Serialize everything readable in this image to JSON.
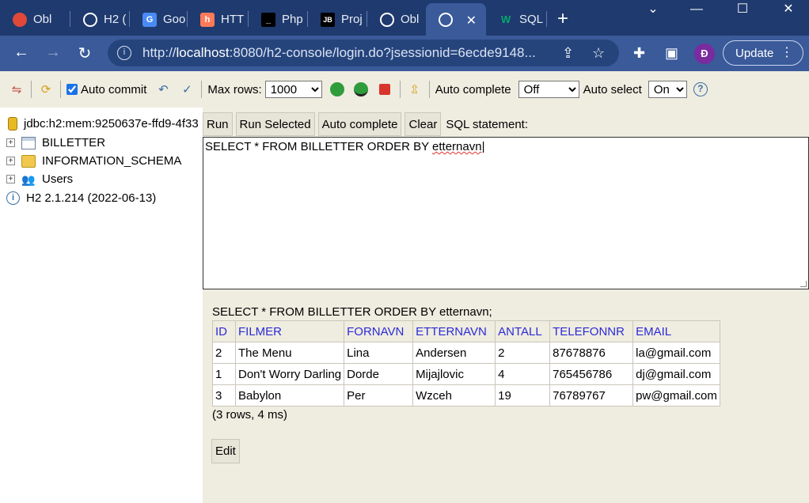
{
  "browser": {
    "tabs": [
      {
        "label": "Obl",
        "icon": "red-circle-icon",
        "color": "#e0483a"
      },
      {
        "label": "H2 (",
        "icon": "globe-icon",
        "color": "#ffffff"
      },
      {
        "label": "Goo",
        "icon": "google-translate-icon",
        "color": "#4a8af4"
      },
      {
        "label": "HTT",
        "icon": "hubspot-icon",
        "color": "#ff7a59"
      },
      {
        "label": "Php",
        "icon": "terminal-icon",
        "color": "#000000"
      },
      {
        "label": "Proj",
        "icon": "jetbrains-icon",
        "color": "#000000"
      },
      {
        "label": "Obl",
        "icon": "globe-icon",
        "color": "#ffffff"
      },
      {
        "label": "",
        "icon": "globe-icon",
        "color": "#ffffff",
        "active": true
      },
      {
        "label": "SQL",
        "icon": "w3schools-icon",
        "color": "#04aa6d"
      }
    ],
    "new_tab": "+",
    "url_host": "localhost",
    "url_prefix": "http://",
    "url_rest": ":8080/h2-console/login.do?jsessionid=6ecde9148...",
    "profile_initial": "Đ",
    "update_label": "Update"
  },
  "toolbar": {
    "auto_commit_label": "Auto commit",
    "max_rows_label": "Max rows:",
    "max_rows_value": "1000",
    "auto_complete_label": "Auto complete",
    "auto_complete_value": "Off",
    "auto_select_label": "Auto select",
    "auto_select_value": "On"
  },
  "tree": {
    "connection": "jdbc:h2:mem:9250637e-ffd9-4f33",
    "items": [
      "BILLETTER",
      "INFORMATION_SCHEMA",
      "Users"
    ],
    "version": "H2 2.1.214 (2022-06-13)"
  },
  "editor": {
    "buttons": {
      "run": "Run",
      "run_selected": "Run Selected",
      "auto_complete": "Auto complete",
      "clear": "Clear"
    },
    "sql_label": "SQL statement:",
    "sql_prefix": "SELECT * FROM BILLETTER ORDER BY ",
    "sql_word": "etternavn"
  },
  "result": {
    "statement": "SELECT * FROM BILLETTER ORDER BY etternavn;",
    "columns": [
      "ID",
      "FILMER",
      "FORNAVN",
      "ETTERNAVN",
      "ANTALL",
      "TELEFONNR",
      "EMAIL"
    ],
    "rows": [
      [
        "2",
        "The Menu",
        "Lina",
        "Andersen",
        "2",
        "87678876",
        "la@gmail.com"
      ],
      [
        "1",
        "Don't Worry Darling",
        "Dorde",
        "Mijajlovic",
        "4",
        "765456786",
        "dj@gmail.com"
      ],
      [
        "3",
        "Babylon",
        "Per",
        "Wzceh",
        "19",
        "76789767",
        "pw@gmail.com"
      ]
    ],
    "summary": "(3 rows, 4 ms)",
    "edit_label": "Edit"
  }
}
